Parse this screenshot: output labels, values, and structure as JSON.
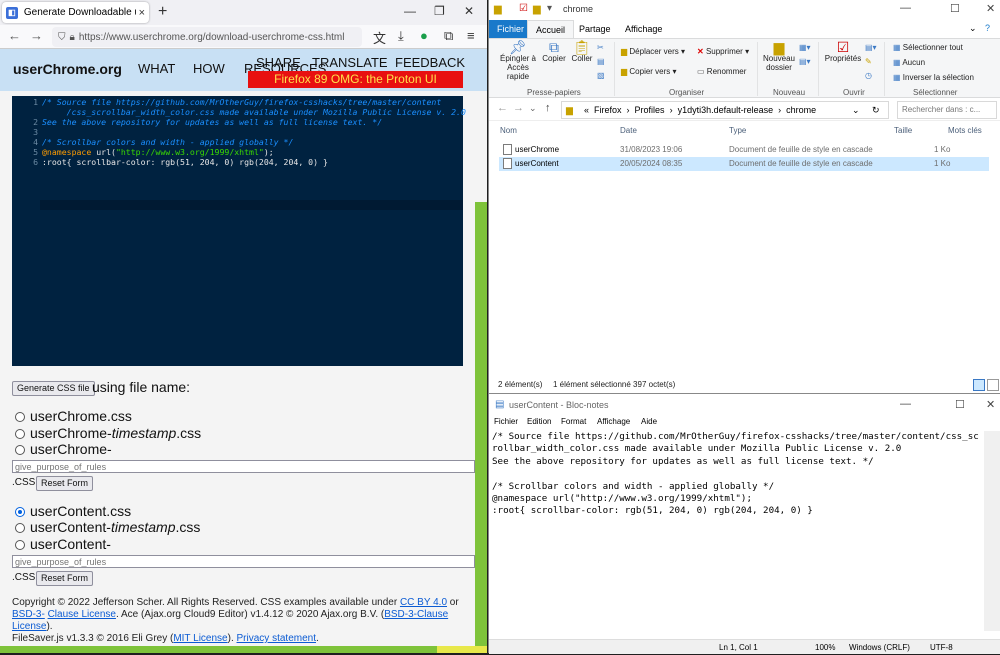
{
  "firefox": {
    "tab_title": "Generate Downloadable userCh",
    "tab_close": "×",
    "new_tab": "+",
    "url": "https://www.userchrome.org/download-userchrome-css.html",
    "site": {
      "logo": "userChrome.org",
      "nav": [
        "WHAT",
        "HOW",
        "SHARE",
        "TRANSLATE",
        "FEEDBACK",
        "RESOURCES"
      ],
      "promo": "Firefox 89 OMG: the Proton UI",
      "code_lines": [
        {
          "n": "1",
          "text": "/* Source file https://github.com/MrOtherGuy/firefox-csshacks/tree/master/content"
        },
        {
          "n": "",
          "text": "     /css_scrollbar_width_color.css made available under Mozilla Public License v. 2.0"
        },
        {
          "n": "2",
          "text": "See the above repository for updates as well as full license text. */"
        },
        {
          "n": "3",
          "text": ""
        },
        {
          "n": "4",
          "text": "/* Scrollbar colors and width - applied globally */"
        },
        {
          "n": "5",
          "text_kw": "@namespace",
          "text_rest": " url(",
          "text_str": "\"http://www.w3.org/1999/xhtml\"",
          "text_end": ");"
        },
        {
          "n": "6",
          "text": ":root{ scrollbar-color: rgb(51, 204, 0) rgb(204, 204, 0) }"
        }
      ],
      "generate_button": "Generate CSS file",
      "using_file_name": "using file name:",
      "chrome_options": [
        "userChrome.css",
        "userChrome-",
        "userChrome-"
      ],
      "timestamp_word": "timestamp",
      "css_suffix": ".css",
      "content_options": [
        "userContent.css",
        "userContent-",
        "userContent-"
      ],
      "purpose_placeholder": "give_purpose_of_rules",
      "css_label": ".CSS",
      "reset_button": "Reset Form",
      "footer": {
        "line1": "Copyright © 2022 Jefferson Scher. All Rights Reserved. CSS examples available under ",
        "cc": "CC BY 4.0",
        "or": " or ",
        "bsd3a": "BSD-3-",
        "bsd3b": "Clause License",
        "ace": ". Ace (Ajax.org Cloud9 Editor) v1.4.12 © 2020 Ajax.org B.V. (",
        "bsd3c": "BSD-3-Clause License",
        "close": ").",
        "filesaver": "FileSaver.js v1.3.3 © 2016 Eli Grey (",
        "mit": "MIT License",
        "mid": "). ",
        "privacy": "Privacy statement",
        "end": "."
      }
    }
  },
  "explorer": {
    "window_title": "chrome",
    "tabs": [
      "Fichier",
      "Accueil",
      "Partage",
      "Affichage"
    ],
    "ribbon": {
      "pin": "Épingler à Accès rapide",
      "copy": "Copier",
      "paste": "Coller",
      "group_clipboard": "Presse-papiers",
      "move_to": "Déplacer vers",
      "copy_to": "Copier vers",
      "delete": "Supprimer",
      "rename": "Renommer",
      "group_organize": "Organiser",
      "new_folder": "Nouveau dossier",
      "group_new": "Nouveau",
      "properties": "Propriétés",
      "group_open": "Ouvrir",
      "select_all": "Sélectionner tout",
      "select_none": "Aucun",
      "invert_selection": "Inverser la sélection",
      "group_select": "Sélectionner"
    },
    "breadcrumb": [
      "«",
      "Firefox",
      "Profiles",
      "y1dyti3h.default-release",
      "chrome"
    ],
    "search_placeholder": "Rechercher dans : c...",
    "columns": [
      "Nom",
      "Date",
      "Type",
      "Taille",
      "Mots clés"
    ],
    "files": [
      {
        "name": "userChrome",
        "date": "31/08/2023 19:06",
        "type": "Document de feuille de style en cascade",
        "size": "1 Ko"
      },
      {
        "name": "userContent",
        "date": "20/05/2024 08:35",
        "type": "Document de feuille de style en cascade",
        "size": "1 Ko"
      }
    ],
    "status_items": "2 élément(s)",
    "status_selected": "1 élément sélectionné  397 octet(s)"
  },
  "notepad": {
    "window_title": "userContent - Bloc-notes",
    "menu": [
      "Fichier",
      "Edition",
      "Format",
      "Affichage",
      "Aide"
    ],
    "content": "/* Source file https://github.com/MrOtherGuy/firefox-csshacks/tree/master/content/css_scrollbar_width_color.css made available under Mozilla Public License v. 2.0\nSee the above repository for updates as well as full license text. */\n\n/* Scrollbar colors and width - applied globally */\n@namespace url(\"http://www.w3.org/1999/xhtml\");\n:root{ scrollbar-color: rgb(51, 204, 0) rgb(204, 204, 0) }",
    "status": {
      "position": "Ln 1, Col 1",
      "zoom": "100%",
      "eol": "Windows (CRLF)",
      "encoding": "UTF-8"
    }
  },
  "colors": {
    "scroll_thumb": "#33cc00",
    "scroll_track": "#cccc00",
    "accent": "#1979ca"
  }
}
